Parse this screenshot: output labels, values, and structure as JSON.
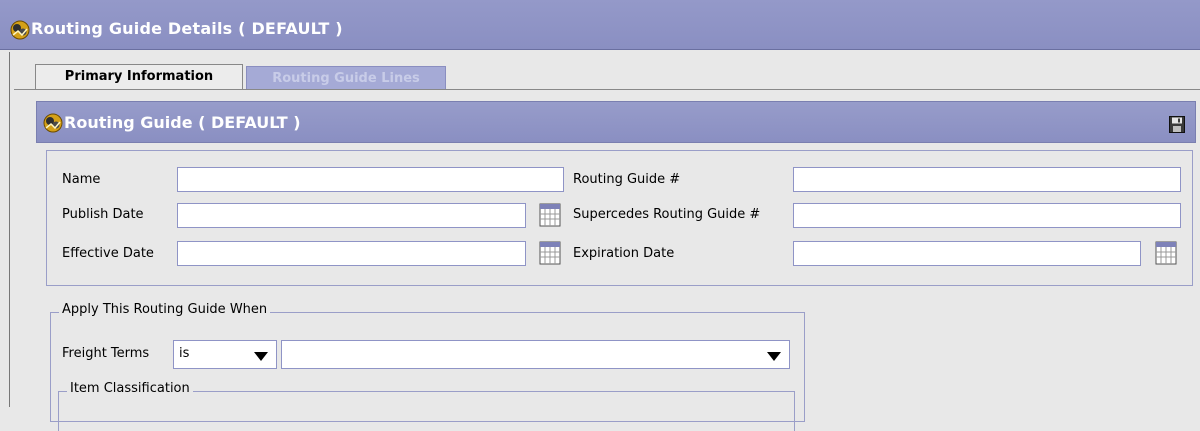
{
  "window": {
    "title": "Routing Guide Details ( DEFAULT )",
    "icon": "routing-guide-icon"
  },
  "tabs": [
    {
      "label": "Primary Information",
      "active": true
    },
    {
      "label": "Routing Guide Lines",
      "active": false
    }
  ],
  "panel": {
    "title": "Routing Guide ( DEFAULT )",
    "icon": "routing-guide-icon",
    "save_icon": "save-icon"
  },
  "form": {
    "name": {
      "label": "Name",
      "value": ""
    },
    "publish_date": {
      "label": "Publish Date",
      "value": ""
    },
    "effective_date": {
      "label": "Effective Date",
      "value": ""
    },
    "routing_guide_no": {
      "label": "Routing Guide #",
      "value": ""
    },
    "supercedes": {
      "label": "Supercedes Routing Guide #",
      "value": ""
    },
    "expiration_date": {
      "label": "Expiration Date",
      "value": ""
    },
    "calendar_icon": "calendar-icon"
  },
  "apply_group": {
    "legend": "Apply This Routing Guide When",
    "freight_terms": {
      "label": "Freight Terms",
      "operator": "is",
      "value": ""
    },
    "item_classification": {
      "legend": "Item Classification"
    }
  },
  "colors": {
    "title_bar": "#8a8fc2",
    "input_border": "#8f94c6",
    "inactive_tab": "#a5aad6"
  }
}
